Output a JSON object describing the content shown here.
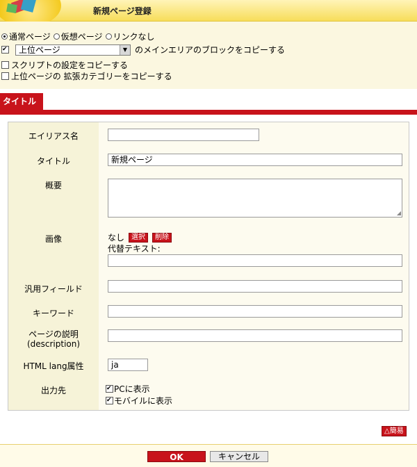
{
  "header": {
    "title": "新規ページ登録"
  },
  "options": {
    "page_types": [
      {
        "label": "通常ページ",
        "checked": true
      },
      {
        "label": "仮想ページ",
        "checked": false
      },
      {
        "label": "リンクなし",
        "checked": false
      }
    ],
    "copy_block": {
      "checked": true,
      "select_value": "上位ページ",
      "suffix": "のメインエリアのブロックをコピーする"
    },
    "copy_script": {
      "checked": false,
      "label": "スクリプトの設定をコピーする"
    },
    "copy_ext_category": {
      "checked": false,
      "label": "上位ページの 拡張カテゴリーをコピーする"
    }
  },
  "tab": {
    "label": "タイトル"
  },
  "form": {
    "alias": {
      "label": "エイリアス名",
      "value": ""
    },
    "title": {
      "label": "タイトル",
      "value": "新規ページ"
    },
    "summary": {
      "label": "概要",
      "value": ""
    },
    "image": {
      "label": "画像",
      "status": "なし",
      "select_label": "選択",
      "delete_label": "削除",
      "alt_label": "代替テキスト:",
      "alt_value": ""
    },
    "generic_field": {
      "label": "汎用フィールド",
      "value": ""
    },
    "keywords": {
      "label": "キーワード",
      "value": ""
    },
    "description": {
      "label_line1": "ページの説明",
      "label_line2": "(description)",
      "value": ""
    },
    "lang": {
      "label": "HTML lang属性",
      "value": "ja"
    },
    "output": {
      "label": "出力先",
      "pc": {
        "label": "PCに表示",
        "checked": true
      },
      "mobile": {
        "label": "モバイルに表示",
        "checked": true
      }
    }
  },
  "simple_label": "△簡易",
  "ok_label": "OK",
  "cancel_label": "キャンセル"
}
